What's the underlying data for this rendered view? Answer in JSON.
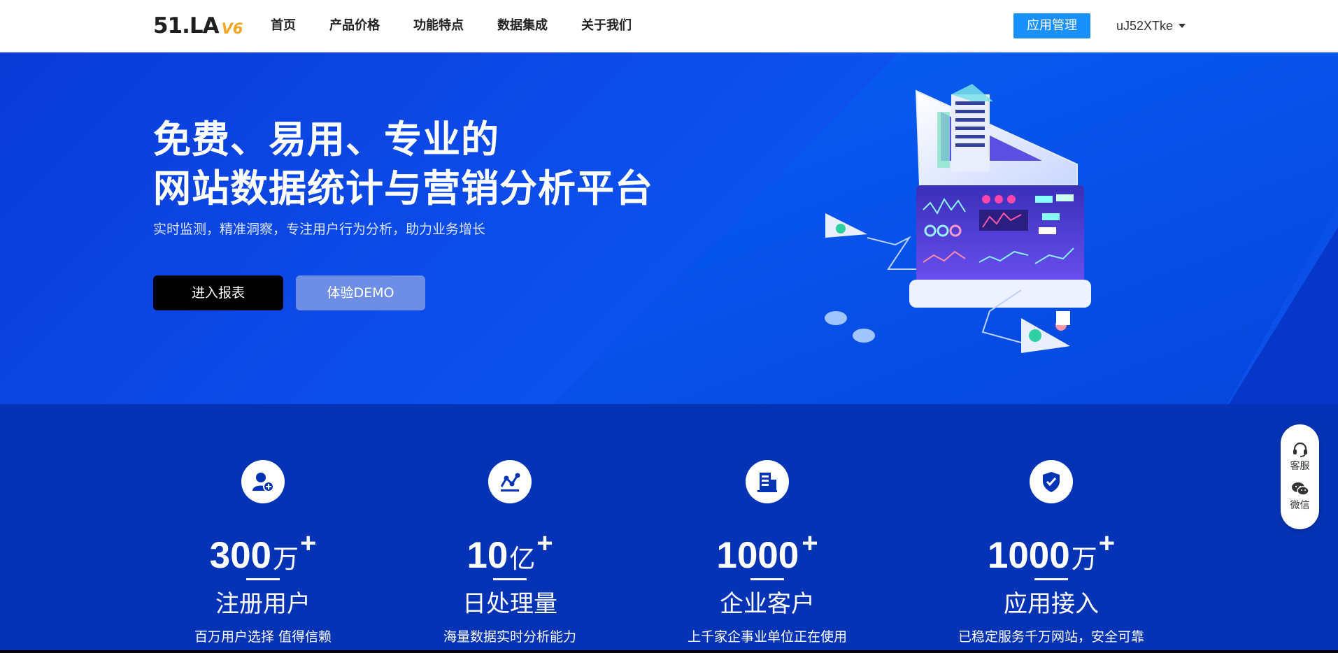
{
  "header": {
    "logo_main": "51.LA",
    "logo_version": "V6",
    "nav": [
      "首页",
      "产品价格",
      "功能特点",
      "数据集成",
      "关于我们"
    ],
    "app_button": "应用管理",
    "username": "uJ52XTke"
  },
  "hero": {
    "title_line1": "免费、易用、专业的",
    "title_line2": "网站数据统计与营销分析平台",
    "subtitle": "实时监测，精准洞察，专注用户行为分析，助力业务增长",
    "report_button": "进入报表",
    "demo_button": "体验DEMO"
  },
  "stats": [
    {
      "number": "300",
      "unit": "万",
      "plus": "+",
      "label": "注册用户",
      "desc": "百万用户选择 值得信赖",
      "icon": "user-add-icon"
    },
    {
      "number": "10",
      "unit": "亿",
      "plus": "+",
      "label": "日处理量",
      "desc": "海量数据实时分析能力",
      "icon": "chart-line-icon"
    },
    {
      "number": "1000",
      "unit": "",
      "plus": "+",
      "label": "企业客户",
      "desc": "上千家企事业单位正在使用",
      "icon": "building-icon"
    },
    {
      "number": "1000",
      "unit": "万",
      "plus": "+",
      "label": "应用接入",
      "desc": "已稳定服务千万网站，安全可靠",
      "icon": "shield-check-icon"
    }
  ],
  "float_widget": {
    "service_label": "客服",
    "wechat_label": "微信"
  },
  "colors": {
    "accent": "#1890ff",
    "hero_blue": "#0b56f0",
    "stats_bg": "#0533b5",
    "logo_version": "#f5a623"
  }
}
